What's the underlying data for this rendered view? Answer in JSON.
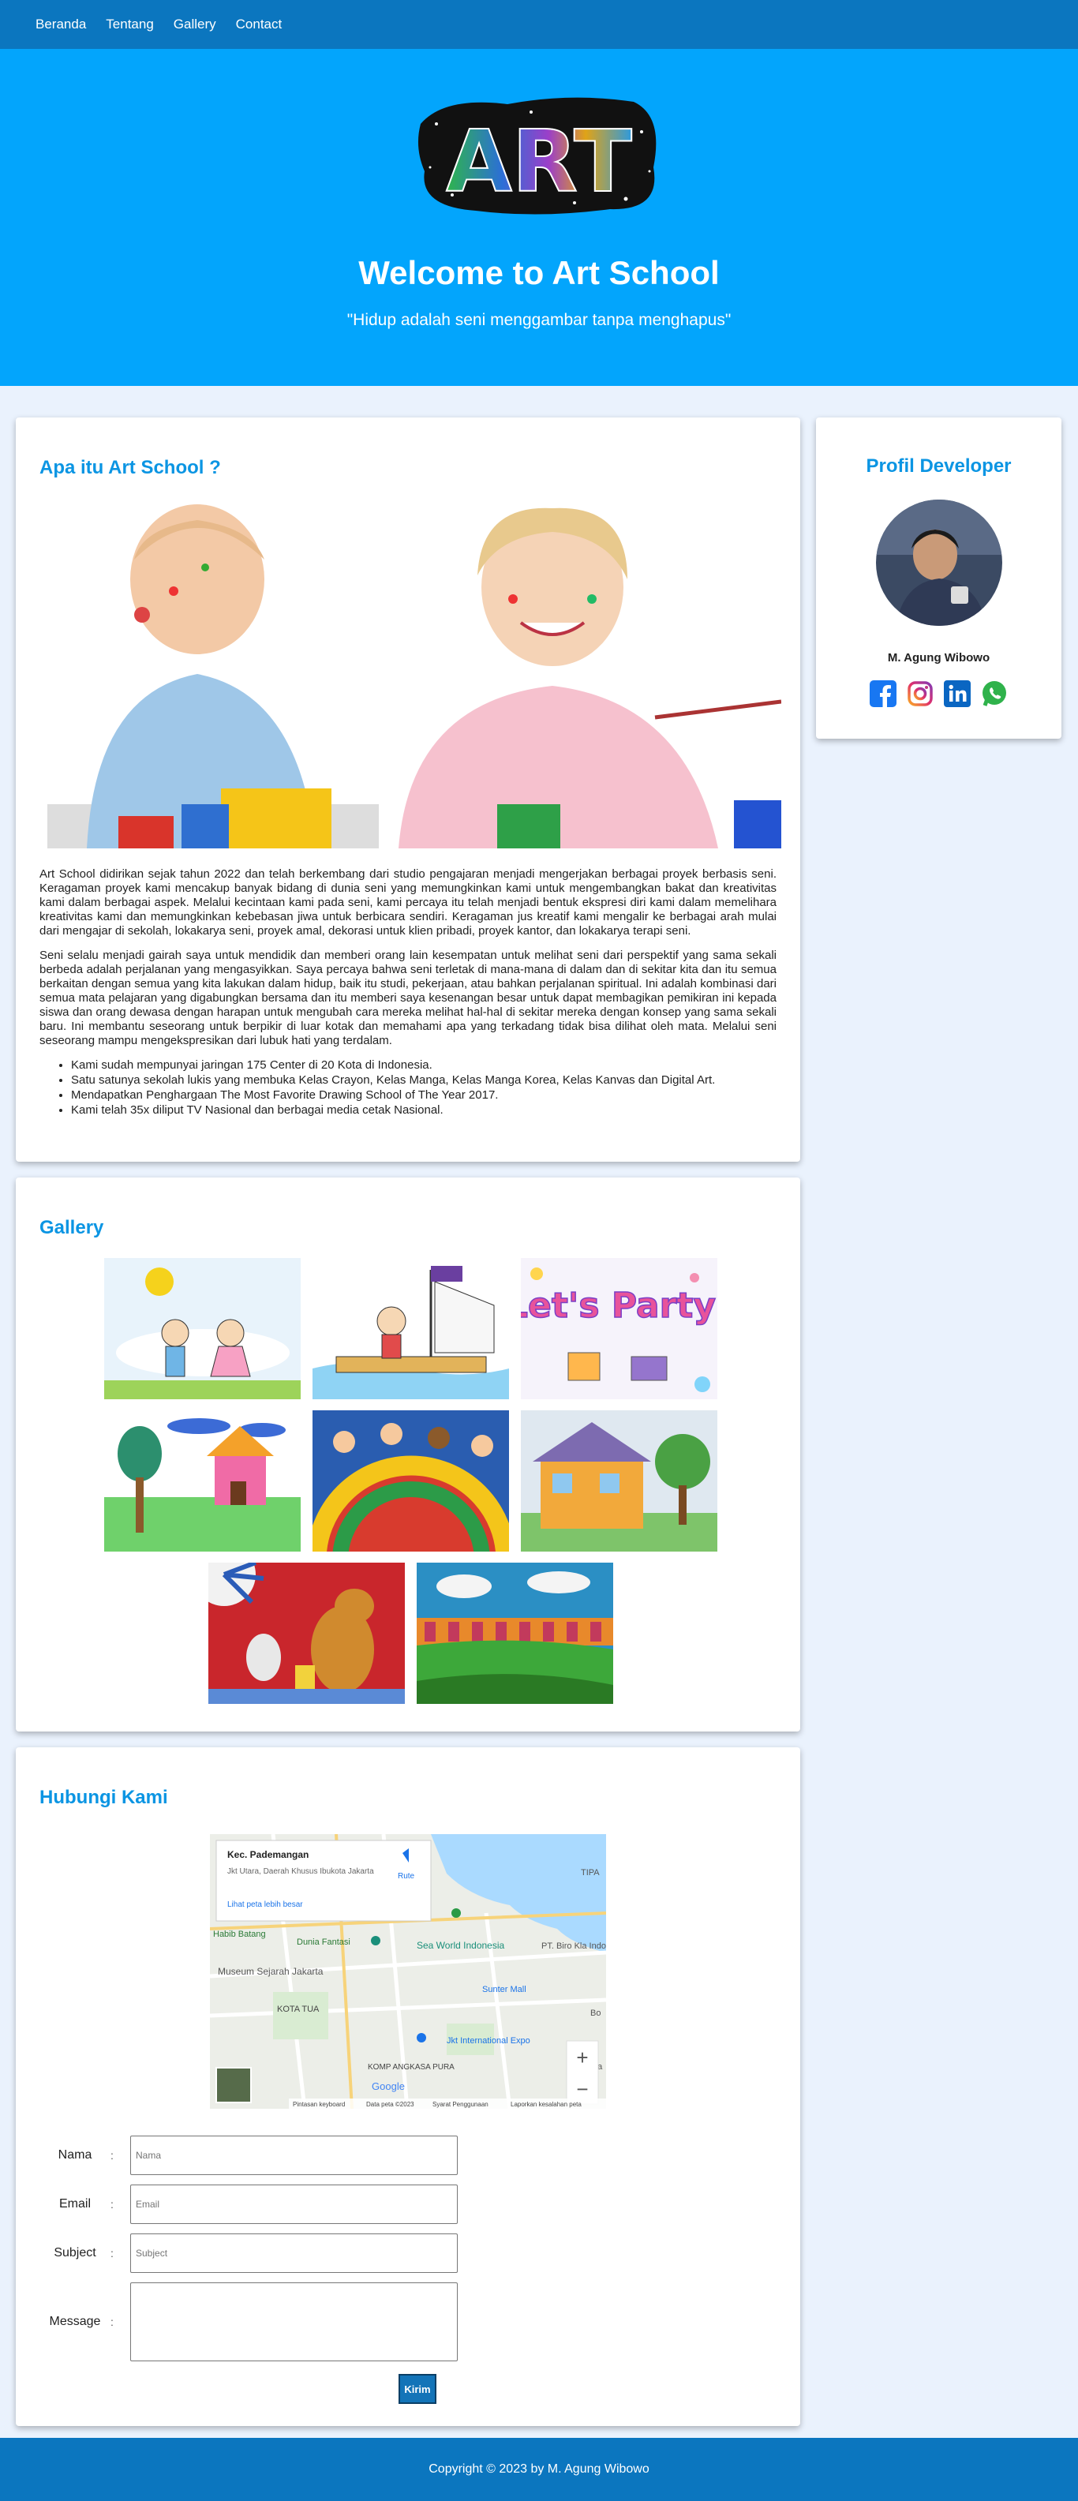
{
  "nav": {
    "items": [
      "Beranda",
      "Tentang",
      "Gallery",
      "Contact"
    ]
  },
  "hero": {
    "logo_text": "ART",
    "title": "Welcome to Art School",
    "subtitle": "\"Hidup adalah seni menggambar tanpa menghapus\""
  },
  "about": {
    "heading": "Apa itu Art School ?",
    "paragraph1": "Art School didirikan sejak tahun 2022 dan telah berkembang dari studio pengajaran menjadi mengerjakan berbagai proyek berbasis seni. Keragaman proyek kami mencakup banyak bidang di dunia seni yang memungkinkan kami untuk mengembangkan bakat dan kreativitas kami dalam berbagai aspek. Melalui kecintaan kami pada seni, kami percaya itu telah menjadi bentuk ekspresi diri kami dalam memelihara kreativitas kami dan memungkinkan kebebasan jiwa untuk berbicara sendiri. Keragaman jus kreatif kami mengalir ke berbagai arah mulai dari mengajar di sekolah, lokakarya seni, proyek amal, dekorasi untuk klien pribadi, proyek kantor, dan lokakarya terapi seni.",
    "paragraph2": "Seni selalu menjadi gairah saya untuk mendidik dan memberi orang lain kesempatan untuk melihat seni dari perspektif yang sama sekali berbeda adalah perjalanan yang mengasyikkan. Saya percaya bahwa seni terletak di mana-mana di dalam dan di sekitar kita dan itu semua berkaitan dengan semua yang kita lakukan dalam hidup, baik itu studi, pekerjaan, atau bahkan perjalanan spiritual. Ini adalah kombinasi dari semua mata pelajaran yang digabungkan bersama dan itu memberi saya kesenangan besar untuk dapat membagikan pemikiran ini kepada siswa dan orang dewasa dengan harapan untuk mengubah cara mereka melihat hal-hal di sekitar mereka dengan konsep yang sama sekali baru. Ini membantu seseorang untuk berpikir di luar kotak dan memahami apa yang terkadang tidak bisa dilihat oleh mata. Melalui seni seseorang mampu mengekspresikan dari lubuk hati yang terdalam.",
    "list": [
      "Kami sudah mempunyai jaringan 175 Center di 20 Kota di Indonesia.",
      "Satu satunya sekolah lukis yang membuka Kelas Crayon, Kelas Manga, Kelas Manga Korea, Kelas Kanvas dan Digital Art.",
      "Mendapatkan Penghargaan The Most Favorite Drawing School of The Year 2017.",
      "Kami telah 35x diliput TV Nasional dan berbagai media cetak Nasional."
    ]
  },
  "developer": {
    "heading": "Profil Developer",
    "name": "M. Agung Wibowo",
    "socials": [
      "facebook-icon",
      "instagram-icon",
      "linkedin-icon",
      "whatsapp-icon"
    ]
  },
  "gallery": {
    "heading": "Gallery",
    "letsparty_text": "Let's Party!"
  },
  "contact": {
    "heading": "Hubungi Kami",
    "map": {
      "place": "Kec. Pademangan",
      "address": "Jkt Utara, Daerah Khusus Ibukota Jakarta",
      "route": "Rute",
      "bigger_map": "Lihat peta lebih besar",
      "labels": [
        "TIPA",
        "Dunia Fantasi",
        "Sea World Indonesia",
        "PT. Biro Kla Indonesia (P",
        "Habib Batang",
        "Museum Sejarah Jakarta",
        "KOTA TUA",
        "Sunter Mall",
        "Bo",
        "Jkt International Expo",
        "KOMP ANGKASA PURA",
        "Ma"
      ],
      "footer": [
        "Pintasan keyboard",
        "Data peta ©2023",
        "Syarat Penggunaan",
        "Laporkan kesalahan peta"
      ],
      "google": "Google"
    },
    "fields": [
      {
        "label": "Nama",
        "placeholder": "Nama"
      },
      {
        "label": "Email",
        "placeholder": "Email"
      },
      {
        "label": "Subject",
        "placeholder": "Subject"
      },
      {
        "label": "Message",
        "placeholder": ""
      }
    ],
    "colon": ":",
    "submit": "Kirim"
  },
  "footer": {
    "text": "Copyright © 2023 by M. Agung Wibowo"
  },
  "colors": {
    "nav": "#0b76bf",
    "hero": "#03a5fc",
    "accent": "#0b95e3",
    "background": "#eaf2fd"
  }
}
